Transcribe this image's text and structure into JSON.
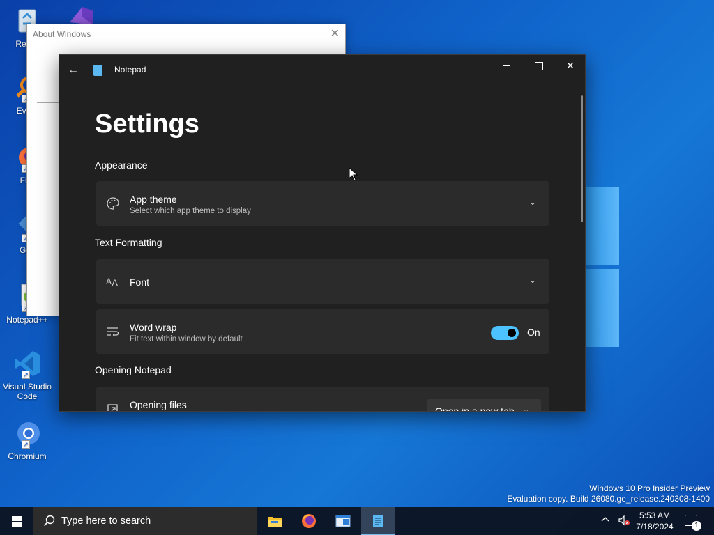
{
  "desktop": {
    "icons": [
      {
        "label": "Recyc",
        "icon": "recycle-bin-icon"
      },
      {
        "label": "Every",
        "icon": "everything-search-icon"
      },
      {
        "label": "Fire",
        "icon": "firefox-icon"
      },
      {
        "label": "Git I",
        "icon": "git-icon"
      },
      {
        "label": "Notepad++",
        "icon": "notepadpp-icon"
      },
      {
        "label": "Visual Studio Code",
        "icon": "vscode-icon"
      },
      {
        "label": "Chromium",
        "icon": "chromium-icon"
      }
    ],
    "watermark": {
      "line1": "Windows 10 Pro Insider Preview",
      "line2": "Evaluation copy. Build 26080.ge_release.240308-1400"
    }
  },
  "about_window": {
    "title": "About Windows",
    "close_glyph": "✕"
  },
  "notepad": {
    "app_title": "Notepad",
    "back_glyph": "←",
    "close_glyph": "✕",
    "page_title": "Settings",
    "sections": {
      "appearance": "Appearance",
      "text_formatting": "Text Formatting",
      "opening": "Opening Notepad"
    },
    "app_theme": {
      "title": "App theme",
      "subtitle": "Select which app theme to display",
      "icon": "palette-icon"
    },
    "font": {
      "title": "Font",
      "icon": "font-icon"
    },
    "word_wrap": {
      "title": "Word wrap",
      "subtitle": "Fit text within window by default",
      "state": "On",
      "enabled": true,
      "icon": "word-wrap-icon"
    },
    "opening_files": {
      "title": "Opening files",
      "value": "Open in a new tab",
      "icon": "open-file-icon"
    },
    "chevron_glyph": "⌄"
  },
  "taskbar": {
    "search_placeholder": "Type here to search",
    "apps": [
      "file-explorer-icon",
      "firefox-icon",
      "window-app-icon",
      "notepad-icon"
    ],
    "active_app": "notepad-icon",
    "time": "5:53 AM",
    "date": "7/18/2024",
    "notification_count": "1",
    "colors": {
      "accent": "#4cc2ff",
      "taskbar": "#0c1422"
    }
  }
}
